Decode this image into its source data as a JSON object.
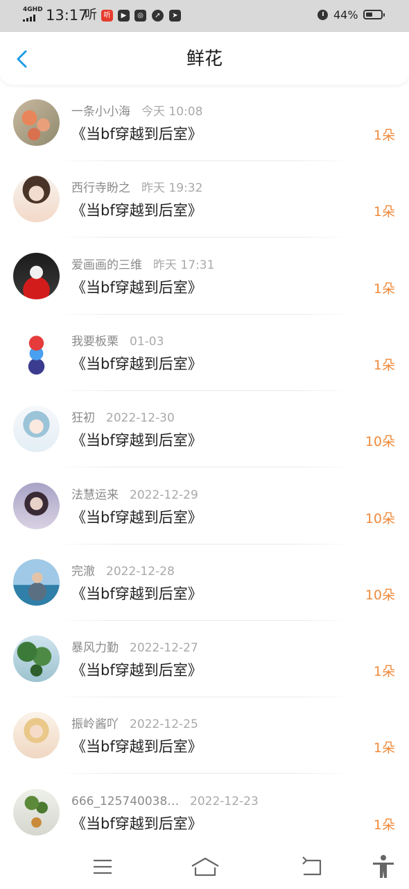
{
  "status_bar": {
    "network": "4GHD",
    "time": "13:17",
    "ting": "听",
    "app_icons": [
      "ting-app-icon",
      "video-app-icon",
      "browser-app-icon",
      "compass-app-icon",
      "send-app-icon"
    ],
    "battery_text": "44%",
    "battery_level": 0.44
  },
  "header": {
    "title": "鲜花"
  },
  "colors": {
    "accent_blue": "#1e9be8",
    "count_orange": "#ef8a3c"
  },
  "items": [
    {
      "name": "一条小小海",
      "time": "今天 10:08",
      "title": "《当bf穿越到后室》",
      "count": "1朵",
      "avatar": "flowers-avatar"
    },
    {
      "name": "西行寺盼之",
      "time": "昨天 19:32",
      "title": "《当bf穿越到后室》",
      "count": "1朵",
      "avatar": "girl-avatar"
    },
    {
      "name": "爱画画的三维",
      "time": "昨天 17:31",
      "title": "《当bf穿越到后室》",
      "count": "1朵",
      "avatar": "dark-character-avatar"
    },
    {
      "name": "我要板栗",
      "time": "01-03",
      "title": "《当bf穿越到后室》",
      "count": "1朵",
      "avatar": "cartoon-boy-avatar"
    },
    {
      "name": "狂初",
      "time": "2022-12-30",
      "title": "《当bf穿越到后室》",
      "count": "10朵",
      "avatar": "anime-girl-avatar"
    },
    {
      "name": "法慧运来",
      "time": "2022-12-29",
      "title": "《当bf穿越到后室》",
      "count": "10朵",
      "avatar": "portrait-avatar"
    },
    {
      "name": "完澈",
      "time": "2022-12-28",
      "title": "《当bf穿越到后室》",
      "count": "10朵",
      "avatar": "sea-avatar"
    },
    {
      "name": "暴风力勤",
      "time": "2022-12-27",
      "title": "《当bf穿越到后室》",
      "count": "1朵",
      "avatar": "tree-avatar"
    },
    {
      "name": "振岭酱吖",
      "time": "2022-12-25",
      "title": "《当bf穿越到后室》",
      "count": "1朵",
      "avatar": "blonde-girl-avatar"
    },
    {
      "name": "666_125740038…",
      "time": "2022-12-23",
      "title": "《当bf穿越到后室》",
      "count": "1朵",
      "avatar": "plant-vase-avatar"
    }
  ],
  "nav": {
    "icons": [
      "menu-icon",
      "home-icon",
      "back-nav-icon",
      "accessibility-icon"
    ]
  }
}
